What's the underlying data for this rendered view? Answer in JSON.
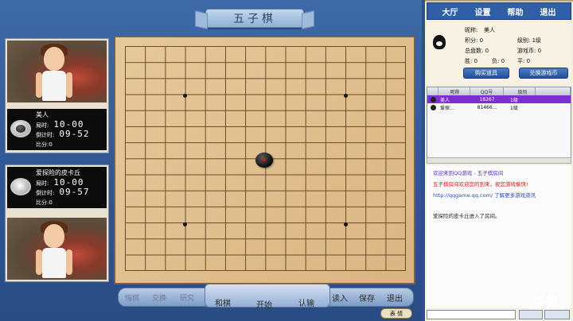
{
  "game": {
    "title": "五子棋",
    "toolbar": [
      {
        "label": "悔棋",
        "dim": true
      },
      {
        "label": "交换",
        "dim": true
      },
      {
        "label": "研究",
        "dim": true
      },
      {
        "label": "和棋",
        "dim": false
      },
      {
        "label": "开始",
        "dim": false
      },
      {
        "label": "认输",
        "dim": false
      },
      {
        "label": "读入",
        "dim": false
      },
      {
        "label": "保存",
        "dim": false
      },
      {
        "label": "退出",
        "dim": false
      }
    ],
    "expression_button": "表 情"
  },
  "player1": {
    "name": "美人",
    "stone": "black",
    "time_label": "局时:",
    "time_value": "10-00",
    "countdown_label": "倒计时:",
    "countdown_value": "09-52",
    "score_label": "比分:",
    "score_value": "0"
  },
  "player2": {
    "name": "爱探险的皮卡丘",
    "stone": "white",
    "time_label": "局时:",
    "time_value": "10-00",
    "countdown_label": "倒计时:",
    "countdown_value": "09-57",
    "score_label": "比分:",
    "score_value": "0"
  },
  "board": {
    "size": 15,
    "stones": [
      {
        "col": 7,
        "row": 7,
        "color": "black",
        "last_move": true
      }
    ]
  },
  "sidebar": {
    "menu": [
      "大厅",
      "设置",
      "帮助",
      "退出"
    ],
    "user": {
      "nickname_label": "昵称:",
      "nickname": "美人",
      "points": "积分: 0",
      "level": "级别: 1级",
      "total_games": "总盘数: 0",
      "coins": "游戏币: 0",
      "wins": "胜: 0",
      "losses": "负: 0",
      "draws": "平: 0"
    },
    "buy_button": "购买道具",
    "exchange_button": "兑换游戏币",
    "list_headers": [
      "",
      "昵称",
      "QQ号",
      "级别"
    ],
    "list_rows": [
      {
        "nick": "美人",
        "qq": "18267",
        "level": "1级",
        "selected": true
      },
      {
        "nick": "爱探...",
        "qq": "81466...",
        "level": "1级",
        "selected": false
      }
    ],
    "chat": [
      {
        "text": "欢迎来到QQ游戏 - 五子棋房间",
        "color": "#5a2fb0"
      },
      {
        "text": "五子棋房间欢迎您的到来，祝您游戏愉快!",
        "color": "#d01818"
      },
      {
        "text": "http://qqgame.qq.com/ 了解更多游戏资讯",
        "color": "#2a48c8"
      },
      {
        "text": "爱探险的皮卡丘进入了房间。",
        "color": "#222222"
      }
    ],
    "watermark": "斗鱼",
    "watermark_sub": "DOUYU.COM"
  }
}
